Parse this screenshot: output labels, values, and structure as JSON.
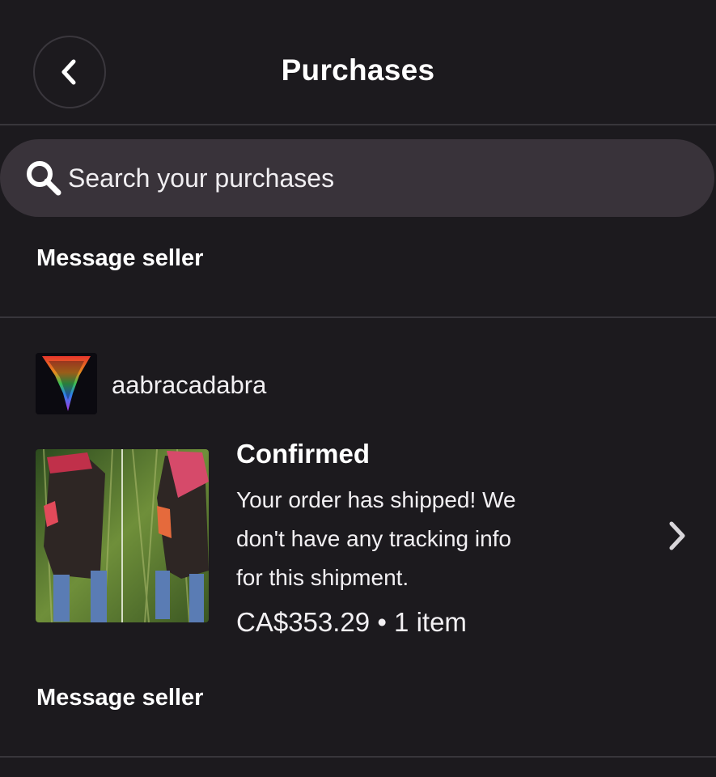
{
  "header": {
    "title": "Purchases",
    "back_icon": "chevron-left-icon"
  },
  "search": {
    "placeholder": "Search your purchases",
    "icon": "search-icon"
  },
  "previous_order": {
    "message_seller_label": "Message seller"
  },
  "order": {
    "shop_name": "aabracadabra",
    "status": "Confirmed",
    "description_lines": [
      "Your order has shipped! We",
      "don't have any tracking info",
      "for this shipment."
    ],
    "price": "CA$353.29",
    "separator": "•",
    "items": "1 item",
    "message_seller_label": "Message seller",
    "chevron_icon": "chevron-right-icon"
  },
  "colors": {
    "background": "#1c1a1e",
    "search_background": "#39333a",
    "divider": "#38363b",
    "text": "#ffffff"
  }
}
